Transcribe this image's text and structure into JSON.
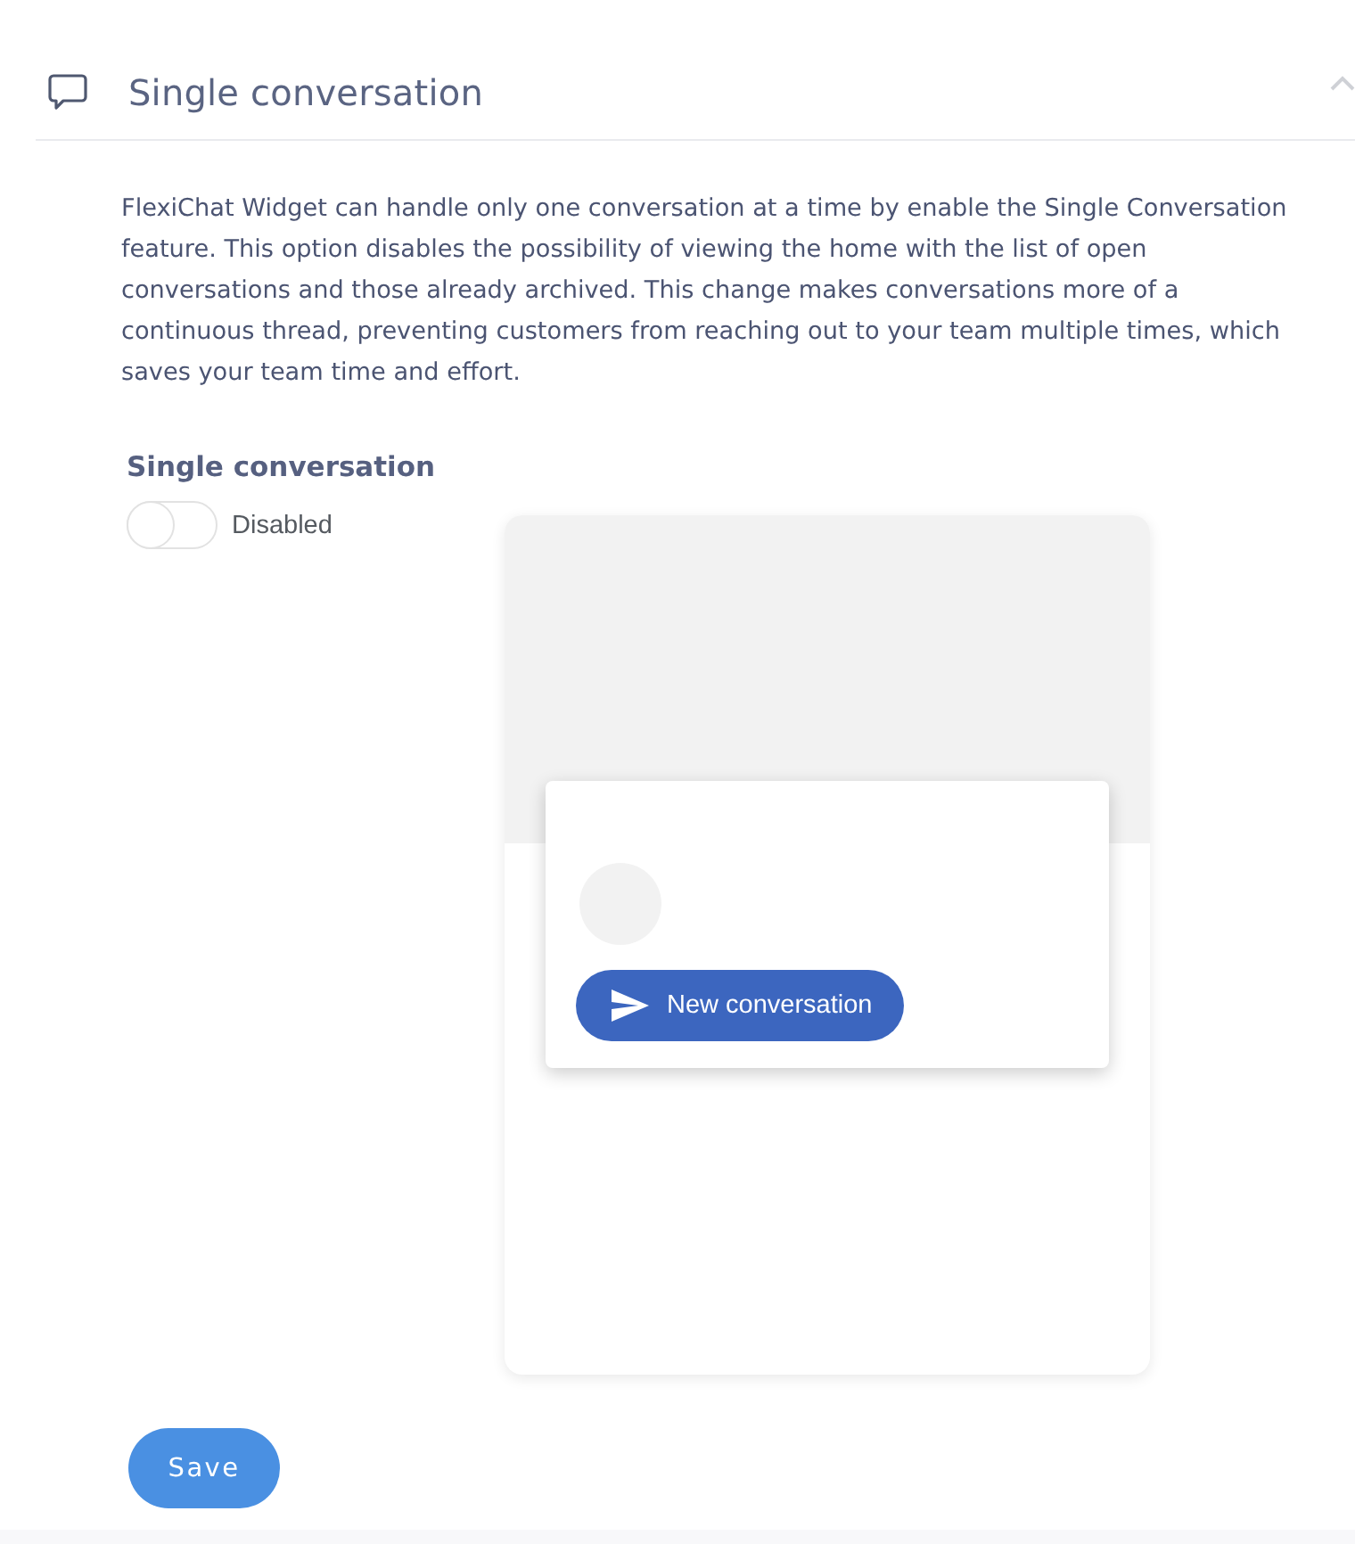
{
  "section": {
    "title": "Single conversation",
    "expanded": true
  },
  "description": "FlexiChat Widget can handle only one conversation at a time by enable the Single Conversation feature. This option disables the possibility of viewing the home with the list of open conversations and those already archived. This change makes conversations more of a continuous thread, preventing customers from reaching out to your team multiple times, which saves your team time and effort.",
  "setting": {
    "label": "Single conversation",
    "on": false,
    "state_label": "Disabled"
  },
  "preview": {
    "button": "New conversation"
  },
  "actions": {
    "save": "Save"
  }
}
